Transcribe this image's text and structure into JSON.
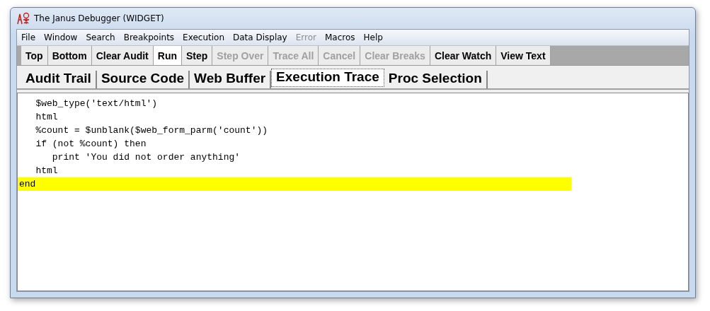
{
  "window": {
    "title": "The Janus Debugger (WIDGET)"
  },
  "menu": [
    {
      "label": "File",
      "disabled": false
    },
    {
      "label": "Window",
      "disabled": false
    },
    {
      "label": "Search",
      "disabled": false
    },
    {
      "label": "Breakpoints",
      "disabled": false
    },
    {
      "label": "Execution",
      "disabled": false
    },
    {
      "label": "Data Display",
      "disabled": false
    },
    {
      "label": "Error",
      "disabled": true
    },
    {
      "label": "Macros",
      "disabled": false
    },
    {
      "label": "Help",
      "disabled": false
    }
  ],
  "toolbar": [
    {
      "label": "Top",
      "disabled": false,
      "selected": false
    },
    {
      "label": "Bottom",
      "disabled": false,
      "selected": false
    },
    {
      "label": "Clear Audit",
      "disabled": false,
      "selected": false
    },
    {
      "label": "Run",
      "disabled": false,
      "selected": true
    },
    {
      "label": "Step",
      "disabled": false,
      "selected": false
    },
    {
      "label": "Step Over",
      "disabled": true,
      "selected": false
    },
    {
      "label": "Trace All",
      "disabled": true,
      "selected": false
    },
    {
      "label": "Cancel",
      "disabled": true,
      "selected": false
    },
    {
      "label": "Clear Breaks",
      "disabled": true,
      "selected": false
    },
    {
      "label": "Clear Watch",
      "disabled": false,
      "selected": false
    },
    {
      "label": "View Text",
      "disabled": false,
      "selected": false
    }
  ],
  "tabs": [
    {
      "label": "Audit Trail",
      "selected": false
    },
    {
      "label": "Source Code",
      "selected": false
    },
    {
      "label": "Web Buffer",
      "selected": false
    },
    {
      "label": "Execution Trace",
      "selected": true
    },
    {
      "label": "Proc Selection",
      "selected": false
    }
  ],
  "code": [
    {
      "text": "   $web_type('text/html')",
      "highlighted": false
    },
    {
      "text": "   html",
      "highlighted": false
    },
    {
      "text": "   %count = $unblank($web_form_parm('count'))",
      "highlighted": false
    },
    {
      "text": "   if (not %count) then",
      "highlighted": false
    },
    {
      "text": "      print 'You did not order anything'",
      "highlighted": false
    },
    {
      "text": "   html",
      "highlighted": false
    },
    {
      "text": "end",
      "highlighted": true
    }
  ]
}
